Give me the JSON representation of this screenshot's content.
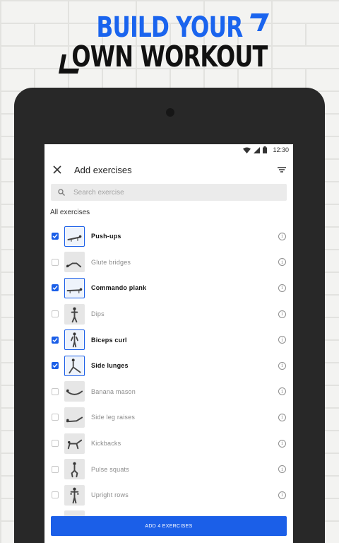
{
  "promo": {
    "line1": "BUILD YOUR",
    "line2": "OWN WORKOUT",
    "accent_color": "#1a64ee"
  },
  "status_bar": {
    "time": "12:30",
    "icons": [
      "wifi-icon",
      "signal-icon",
      "battery-icon"
    ]
  },
  "app_bar": {
    "title": "Add exercises",
    "left_icon": "close-icon",
    "right_icon": "filter-icon"
  },
  "search": {
    "placeholder": "Search exercise",
    "value": "",
    "icon": "search-icon"
  },
  "section_label": "All exercises",
  "exercises": [
    {
      "name": "Push-ups",
      "checked": true
    },
    {
      "name": "Glute bridges",
      "checked": false
    },
    {
      "name": "Commando plank",
      "checked": true
    },
    {
      "name": "Dips",
      "checked": false
    },
    {
      "name": "Biceps curl",
      "checked": true
    },
    {
      "name": "Side lunges",
      "checked": true
    },
    {
      "name": "Banana mason",
      "checked": false
    },
    {
      "name": "Side leg raises",
      "checked": false
    },
    {
      "name": "Kickbacks",
      "checked": false
    },
    {
      "name": "Pulse squats",
      "checked": false
    },
    {
      "name": "Upright rows",
      "checked": false
    }
  ],
  "add_button_label": "ADD 4 EXERCISES",
  "colors": {
    "primary": "#1b5fe8",
    "tablet_frame": "#282828"
  }
}
